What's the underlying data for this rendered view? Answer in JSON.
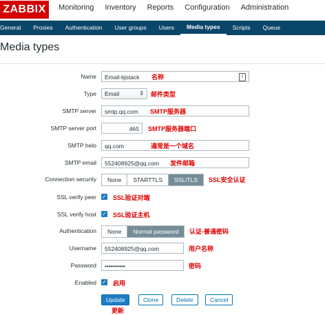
{
  "logo": "ZABBIX",
  "top_nav": [
    "Monitoring",
    "Inventory",
    "Reports",
    "Configuration",
    "Administration"
  ],
  "sub_nav": [
    "General",
    "Proxies",
    "Authentication",
    "User groups",
    "Users",
    "Media types",
    "Scripts",
    "Queue"
  ],
  "page_title": "Media types",
  "form": {
    "name": {
      "label": "Name",
      "value": "Email-bjstack",
      "note": "名称"
    },
    "type": {
      "label": "Type",
      "value": "Email",
      "note": "邮件类型"
    },
    "smtp_server": {
      "label": "SMTP server",
      "value": "smtp.qq.com",
      "note": "SMTP服务器"
    },
    "smtp_port": {
      "label": "SMTP server port",
      "value": "465",
      "note": "SMTP服务器端口"
    },
    "smtp_helo": {
      "label": "SMTP helo",
      "value": "qq.com",
      "note": "通常是一个域名"
    },
    "smtp_email": {
      "label": "SMTP email",
      "value": "552408925@qq.com",
      "note": "发件邮箱"
    },
    "connection_security": {
      "label": "Connection security",
      "options": [
        "None",
        "STARTTLS",
        "SSL/TLS"
      ],
      "selected": "SSL/TLS",
      "note": "SSL安全认证"
    },
    "ssl_verify_peer": {
      "label": "SSL verify peer",
      "checked": true,
      "note": "SSL验证对端"
    },
    "ssl_verify_host": {
      "label": "SSL verify host",
      "checked": true,
      "note": "SSL验证主机"
    },
    "authentication": {
      "label": "Authentication",
      "options": [
        "None",
        "Normal password"
      ],
      "selected": "Normal password",
      "note": "认证-普通密码"
    },
    "username": {
      "label": "Username",
      "value": "552408925@qq.com",
      "note": "用户名称"
    },
    "password": {
      "label": "Password",
      "value": "••••••••••",
      "note": "密码"
    },
    "enabled": {
      "label": "Enabled",
      "checked": true,
      "note": "启用"
    }
  },
  "buttons": {
    "update": "Update",
    "clone": "Clone",
    "delete": "Delete",
    "cancel": "Cancel",
    "update_note": "更新"
  },
  "colors": {
    "brand": "#d40000",
    "subnav": "#0a466a",
    "primary": "#1c7dc5",
    "note": "#e00000"
  }
}
